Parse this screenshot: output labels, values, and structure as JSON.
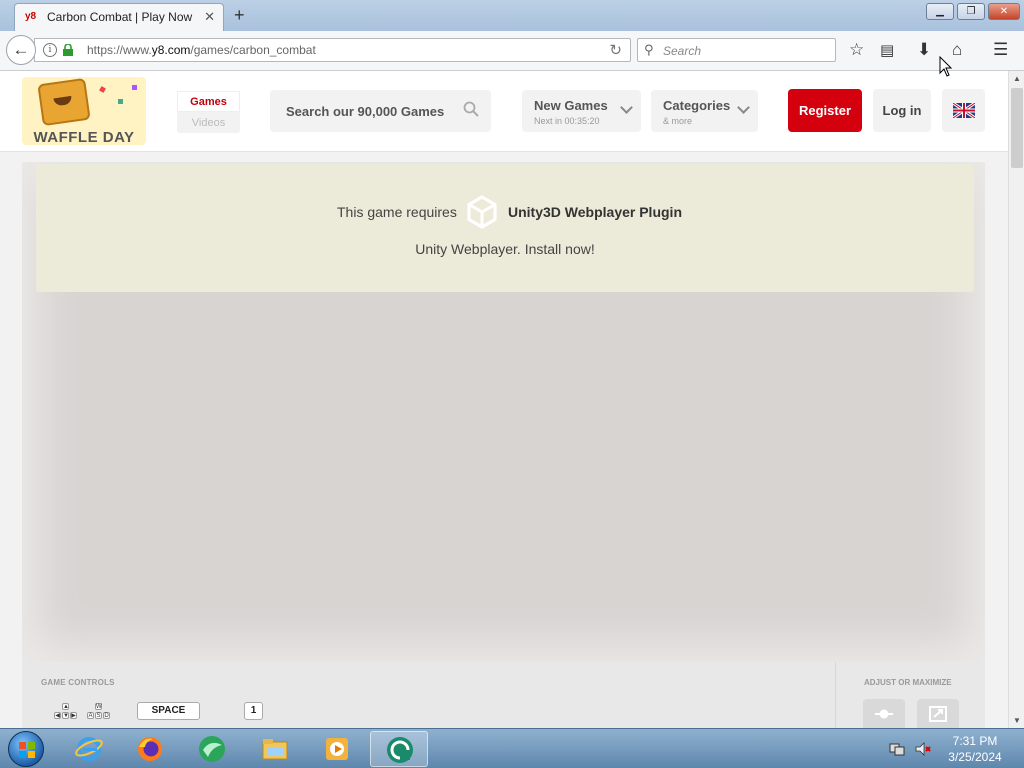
{
  "browser": {
    "tab_title": "Carbon Combat | Play Now",
    "favicon_text": "y8",
    "new_tab_symbol": "+",
    "url_prefix": "https://www.",
    "url_domain": "y8.com",
    "url_path": "/games/carbon_combat",
    "search_placeholder": "Search",
    "window_buttons": [
      "minimize",
      "maximize",
      "close"
    ]
  },
  "header": {
    "logo_text": "WAFFLE DAY",
    "media_switch": {
      "games": "Games",
      "videos": "Videos"
    },
    "search_placeholder": "Search our 90,000 Games",
    "new_games": {
      "title": "New Games",
      "subtitle": "Next in 00:35:20"
    },
    "categories": {
      "title": "Categories",
      "subtitle": "& more"
    },
    "register_label": "Register",
    "login_label": "Log in",
    "language_icon": "uk-flag-icon",
    "accent_color": "#d4000e"
  },
  "game": {
    "requires_text": "This game requires",
    "plugin_name": "Unity3D Webplayer Plugin",
    "install_text": "Unity Webplayer. Install now!"
  },
  "controls": {
    "label": "GAME CONTROLS",
    "arrow_keys": [
      "▲",
      "◀",
      "▼",
      "▶"
    ],
    "wasd_keys": [
      "W",
      "A",
      "S",
      "D"
    ],
    "space_key": "SPACE",
    "number_key": "1",
    "adjust_label": "ADJUST OR MAXIMIZE"
  },
  "taskbar": {
    "apps": [
      "internet-explorer",
      "firefox",
      "app-green-circle",
      "file-explorer",
      "media-player",
      "unity-webplayer"
    ],
    "time": "7:31 PM",
    "date": "3/25/2024"
  }
}
